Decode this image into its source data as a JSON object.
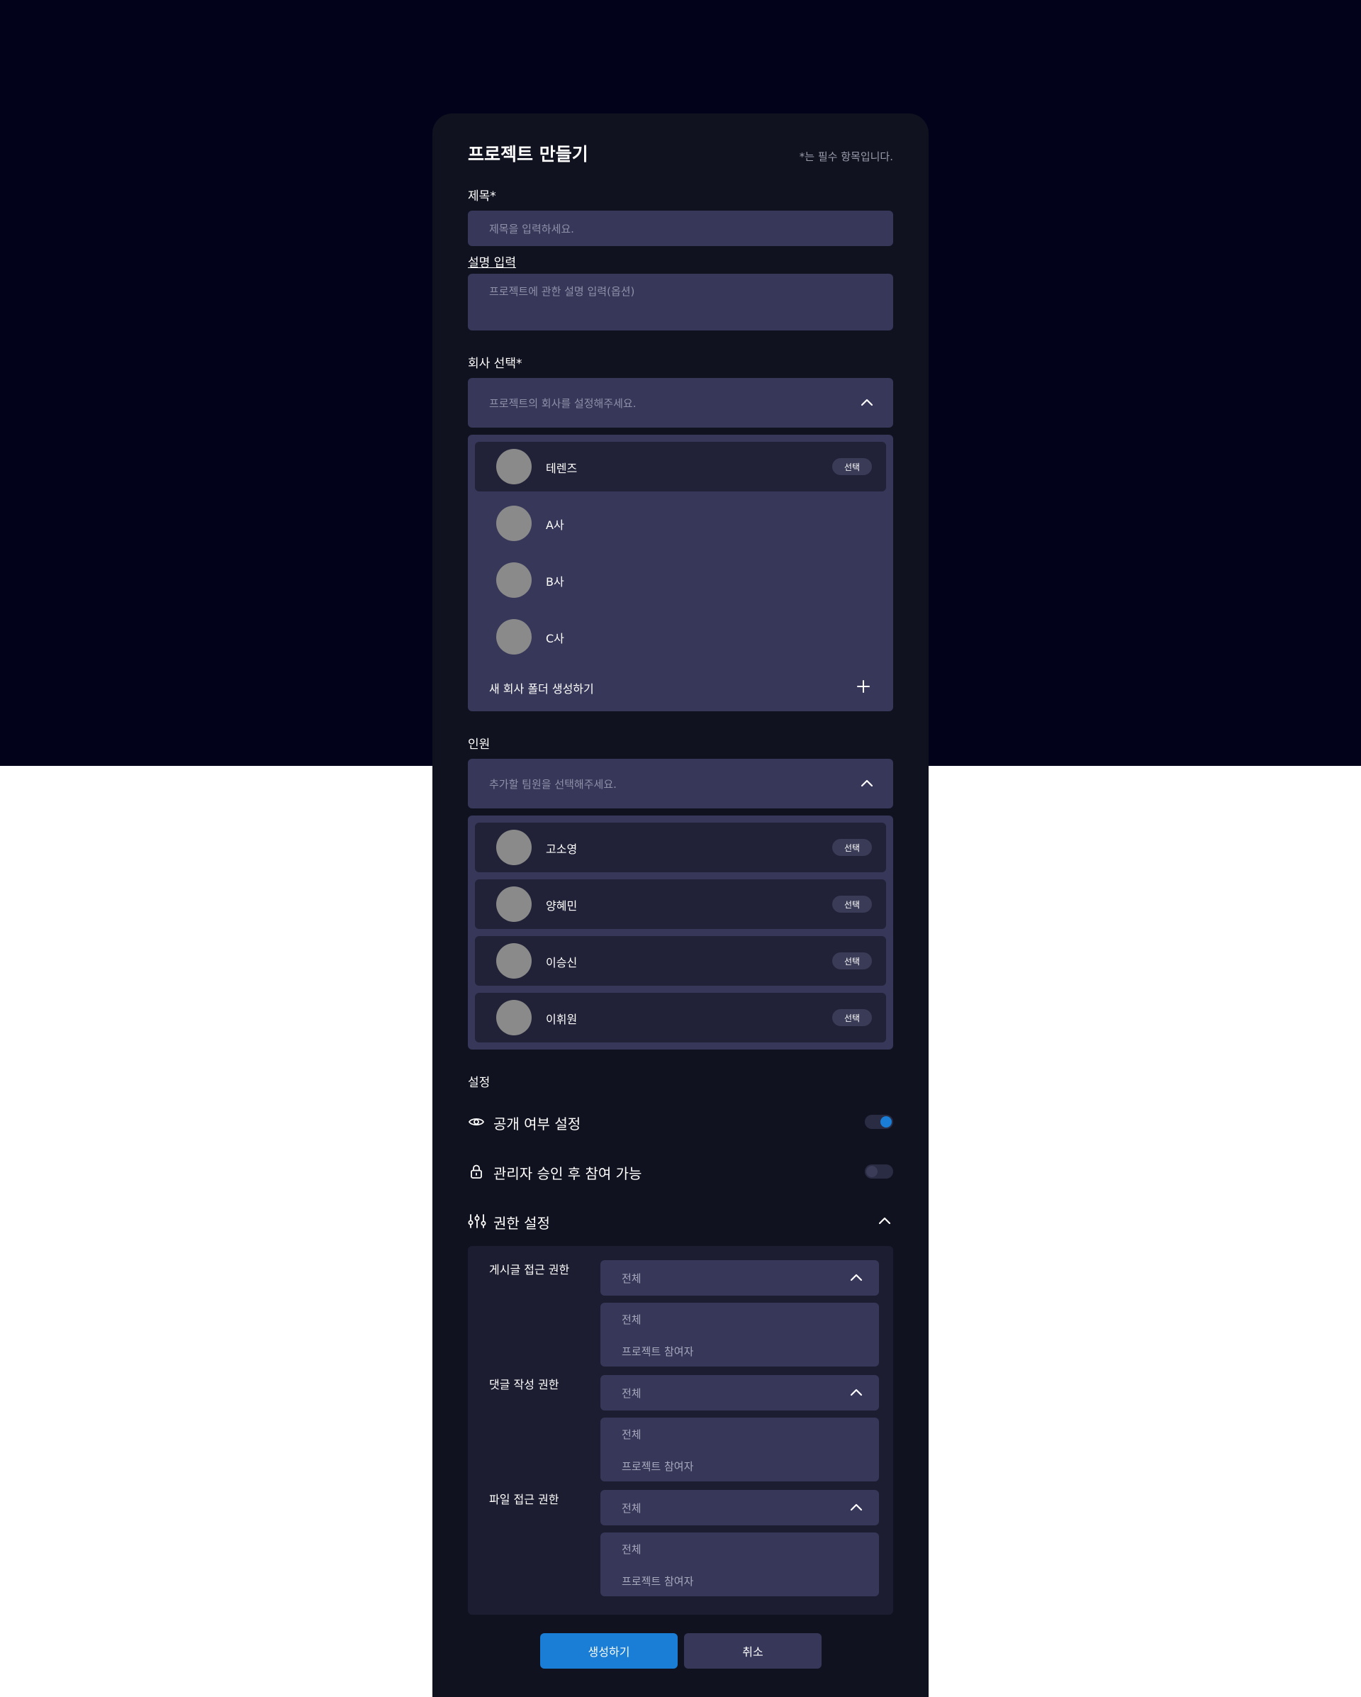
{
  "modal": {
    "title": "프로젝트 만들기",
    "required_note": "*는 필수 항목입니다."
  },
  "title_field": {
    "label": "제목*",
    "placeholder": "제목을 입력하세요."
  },
  "description_field": {
    "label": "설명 입력",
    "placeholder": "프로젝트에 관한 설명 입력(옵션)"
  },
  "company": {
    "label": "회사 선택*",
    "placeholder": "프로젝트의 회사를 설정해주세요.",
    "items": [
      {
        "name": "테렌즈",
        "badge": "선택"
      },
      {
        "name": "A사"
      },
      {
        "name": "B사"
      },
      {
        "name": "C사"
      }
    ],
    "new_folder": "새 회사 폴더 생성하기"
  },
  "members": {
    "label": "인원",
    "placeholder": "추가할 팀원을 선택해주세요.",
    "items": [
      {
        "name": "고소영",
        "badge": "선택"
      },
      {
        "name": "양혜민",
        "badge": "선택"
      },
      {
        "name": "이승신",
        "badge": "선택"
      },
      {
        "name": "이휘원",
        "badge": "선택"
      }
    ]
  },
  "settings": {
    "label": "설정",
    "public": {
      "label": "공개 여부 설정",
      "enabled": true,
      "icon": "eye-icon"
    },
    "approval": {
      "label": "관리자 승인 후 참여 가능",
      "enabled": false,
      "icon": "lock-icon"
    },
    "permissions": {
      "label": "권한 설정",
      "icon": "sliders-icon",
      "rows": [
        {
          "label": "게시글 접근 권한",
          "value": "전체",
          "options": [
            "전체",
            "프로젝트 참여자"
          ]
        },
        {
          "label": "댓글 작성 권한",
          "value": "전체",
          "options": [
            "전체",
            "프로젝트 참여자"
          ]
        },
        {
          "label": "파일 접근 권한",
          "value": "전체",
          "options": [
            "전체",
            "프로젝트 참여자"
          ]
        }
      ]
    }
  },
  "actions": {
    "create": "생성하기",
    "cancel": "취소"
  },
  "colors": {
    "background_dark": "#02031a",
    "modal": "#11121f",
    "field": "#37375a",
    "selected_row": "#212237",
    "accent": "#1a7ed6"
  }
}
